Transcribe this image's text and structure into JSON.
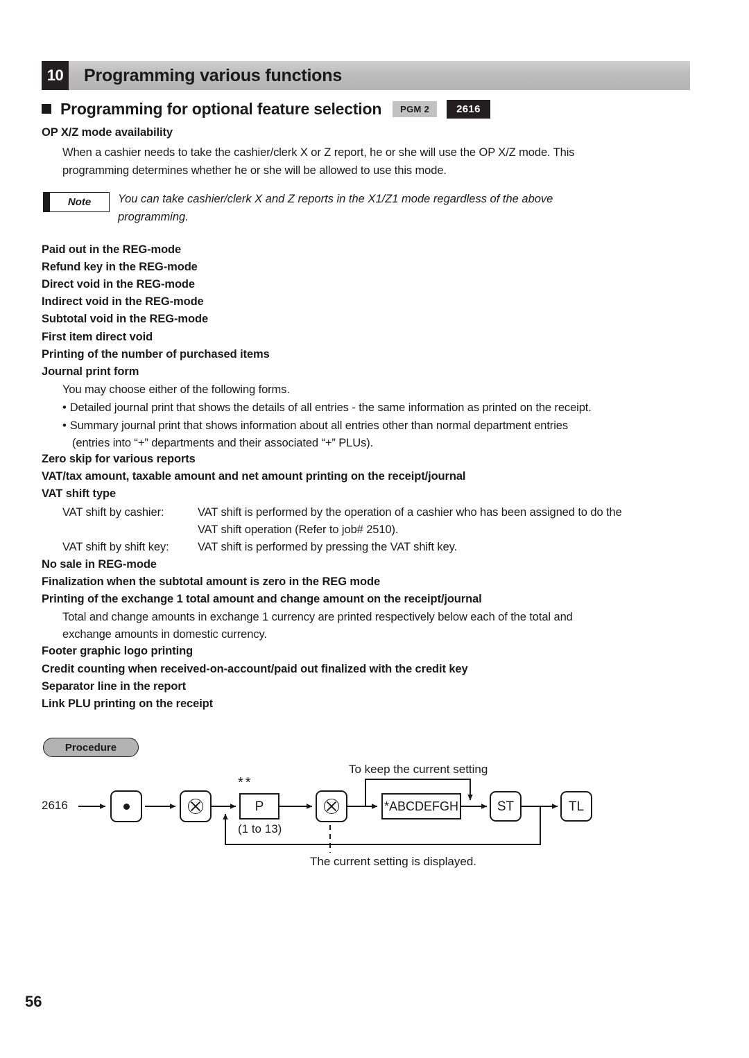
{
  "chapter": {
    "number": "10",
    "title": "Programming various functions"
  },
  "section": {
    "title": "Programming for optional feature selection",
    "badge_mode": "PGM 2",
    "badge_job": "2616"
  },
  "body": {
    "heading_opxz": "OP X/Z mode availability",
    "para_opxz_line1": "When a cashier needs to take the cashier/clerk X or Z report, he or she will use the OP X/Z mode.  This",
    "para_opxz_line2": "programming determines whether he or she will be allowed to use this mode.",
    "note_label": "Note",
    "note_line1": "You can take cashier/clerk X and Z reports in the X1/Z1 mode regardless of the above",
    "note_line2": "programming.",
    "headings_group1": [
      "Paid out in the REG-mode",
      "Refund key in the REG-mode",
      "Direct void in the REG-mode",
      "Indirect void in the REG-mode",
      "Subtotal void in the REG-mode",
      "First item direct void",
      "Printing of the number of purchased items",
      "Journal print form"
    ],
    "journal_intro": "You may choose either of the following forms.",
    "journal_bullets": [
      "Detailed journal print that shows the details of all entries - the same information as printed on the receipt.",
      "Summary journal print that shows information about all entries other than normal department entries"
    ],
    "journal_bullet2_cont": "(entries into “+” departments and their associated “+” PLUs).",
    "headings_group2": [
      "Zero skip for various reports",
      "VAT/tax amount, taxable amount and net amount printing on the receipt/journal",
      "VAT shift type"
    ],
    "vat_rows": [
      {
        "label": "VAT shift by cashier:",
        "desc_line1": "VAT shift is performed by the operation of a cashier who has been assigned to do the",
        "desc_line2": "VAT shift operation (Refer to job# 2510)."
      },
      {
        "label": "VAT shift by shift key:",
        "desc_line1": "VAT shift is performed by pressing the VAT shift key.",
        "desc_line2": ""
      }
    ],
    "headings_group3": [
      "No sale in REG-mode",
      "Finalization when the subtotal amount is zero in the REG mode",
      "Printing of the exchange 1 total amount and change amount on the receipt/journal"
    ],
    "exchange_line1": "Total and change amounts in exchange 1 currency are printed respectively below each of the total and",
    "exchange_line2": "exchange amounts in domestic currency.",
    "headings_group4": [
      "Footer graphic logo printing",
      "Credit counting when received-on-account/paid out finalized with the credit key",
      "Separator line in the report",
      "Link PLU printing on the receipt"
    ]
  },
  "procedure": {
    "label": "Procedure",
    "start_code": "2616",
    "key_dot": "•",
    "key_multiply_1": "multiply-key",
    "key_multiply_2": "multiply-key",
    "param_box": "P",
    "param_asterisks": "**",
    "param_range": "(1 to 13)",
    "setting_box": "*ABCDEFGH",
    "key_st": "ST",
    "key_tl": "TL",
    "label_keep": "To keep the current setting",
    "label_displayed": "The current setting is displayed."
  },
  "footer": {
    "page_number": "56"
  },
  "colors": {
    "header_gray": "#bdbdbd",
    "badge_black": "#231f20",
    "badge_gray": "#c2c2c2",
    "procedure_gray": "#b3b3b3",
    "ink": "#1a1a1a"
  }
}
